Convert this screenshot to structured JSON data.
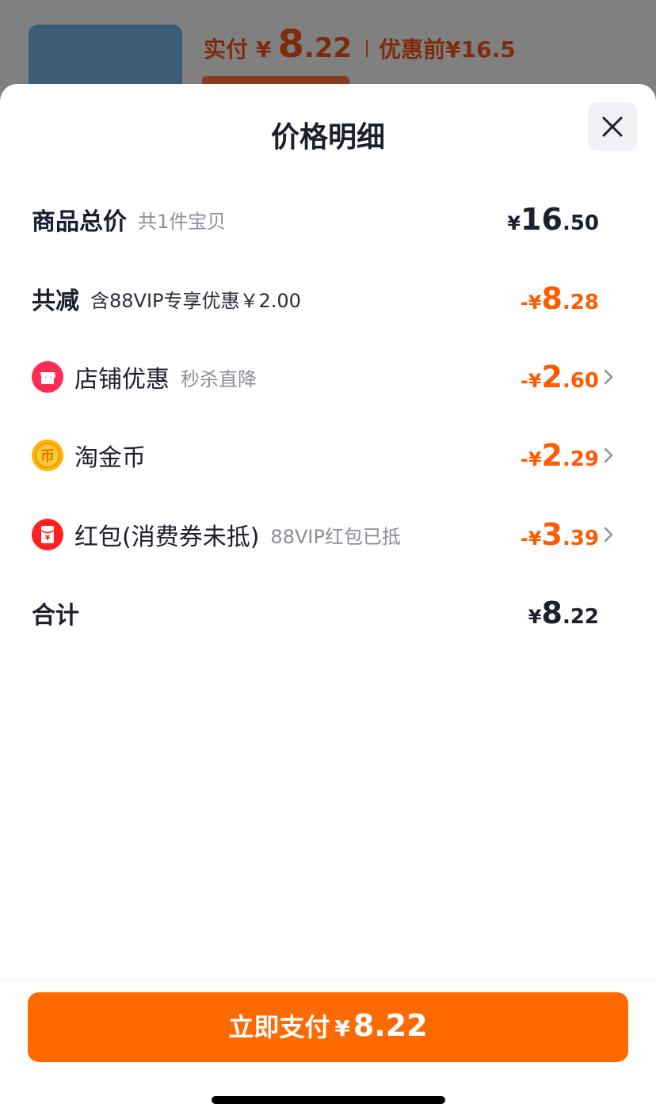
{
  "background": {
    "paid_label": "实付",
    "paid_yen": "¥",
    "paid_int": "8",
    "paid_dec": ".22",
    "original_label": "优惠前",
    "original_price": "¥16.5"
  },
  "sheet": {
    "title": "价格明细",
    "close_icon": "close-icon"
  },
  "rows": {
    "total": {
      "label": "商品总价",
      "sub": "共1件宝贝",
      "yen": "¥",
      "int": "16",
      "dec": ".50"
    },
    "discount": {
      "label": "共减",
      "sub": "含88VIP专享优惠￥2.00",
      "sign": "-",
      "yen": "¥",
      "int": "8",
      "dec": ".28"
    },
    "shop": {
      "icon": "store-icon",
      "label": "店铺优惠",
      "sub": "秒杀直降",
      "sign": "-",
      "yen": "¥",
      "int": "2",
      "dec": ".60"
    },
    "coin": {
      "icon": "coin-icon",
      "label": "淘金币",
      "sign": "-",
      "yen": "¥",
      "int": "2",
      "dec": ".29"
    },
    "redpacket": {
      "icon": "red-packet-icon",
      "label": "红包(消费券未抵)",
      "sub": "88VIP红包已抵",
      "sign": "-",
      "yen": "¥",
      "int": "3",
      "dec": ".39"
    },
    "sum": {
      "label": "合计",
      "yen": "¥",
      "int": "8",
      "dec": ".22"
    }
  },
  "pay_button": {
    "label": "立即支付",
    "yen": "¥",
    "amount": "8.22"
  },
  "colors": {
    "accent": "#ff6a00",
    "discount_text": "#ff5a00",
    "text_primary": "#1b1f2e",
    "text_secondary": "#8a8f99"
  }
}
